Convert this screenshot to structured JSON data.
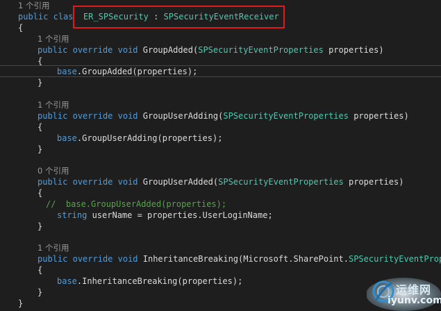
{
  "editor": {
    "lines": [
      {
        "id": "l0",
        "kind": "lens",
        "text": "1 个引用"
      },
      {
        "id": "l1",
        "parts": [
          {
            "c": "kw",
            "t": "public"
          },
          {
            "c": "plain",
            "t": " "
          },
          {
            "c": "kw",
            "t": "clas"
          },
          {
            "c": "plain",
            "t": "  "
          },
          {
            "c": "type",
            "t": "ER_SPSecurity"
          },
          {
            "c": "plain",
            "t": " : "
          },
          {
            "c": "type",
            "t": "SPSecurityEventReceiver"
          }
        ]
      },
      {
        "id": "l2",
        "parts": [
          {
            "c": "plain",
            "t": "{"
          }
        ]
      },
      {
        "id": "l3",
        "kind": "lens",
        "text": "1 个引用"
      },
      {
        "id": "l4",
        "parts": [
          {
            "c": "kw",
            "t": "public"
          },
          {
            "c": "plain",
            "t": " "
          },
          {
            "c": "kw",
            "t": "override"
          },
          {
            "c": "plain",
            "t": " "
          },
          {
            "c": "kw",
            "t": "void"
          },
          {
            "c": "plain",
            "t": " GroupAdded("
          },
          {
            "c": "type",
            "t": "SPSecurityEventProperties"
          },
          {
            "c": "plain",
            "t": " properties)"
          }
        ]
      },
      {
        "id": "l5",
        "parts": [
          {
            "c": "plain",
            "t": "{"
          }
        ]
      },
      {
        "id": "l6",
        "parts": [
          {
            "c": "kw",
            "t": "base"
          },
          {
            "c": "plain",
            "t": ".GroupAdded(properties);"
          }
        ]
      },
      {
        "id": "l7",
        "parts": [
          {
            "c": "plain",
            "t": "}"
          }
        ]
      },
      {
        "id": "l8",
        "kind": "lens",
        "text": "1 个引用"
      },
      {
        "id": "l9",
        "parts": [
          {
            "c": "kw",
            "t": "public"
          },
          {
            "c": "plain",
            "t": " "
          },
          {
            "c": "kw",
            "t": "override"
          },
          {
            "c": "plain",
            "t": " "
          },
          {
            "c": "kw",
            "t": "void"
          },
          {
            "c": "plain",
            "t": " GroupUserAdding("
          },
          {
            "c": "type",
            "t": "SPSecurityEventProperties"
          },
          {
            "c": "plain",
            "t": " properties)"
          }
        ]
      },
      {
        "id": "l10",
        "parts": [
          {
            "c": "plain",
            "t": "{"
          }
        ]
      },
      {
        "id": "l11",
        "parts": [
          {
            "c": "kw",
            "t": "base"
          },
          {
            "c": "plain",
            "t": ".GroupUserAdding(properties);"
          }
        ]
      },
      {
        "id": "l12",
        "parts": [
          {
            "c": "plain",
            "t": "}"
          }
        ]
      },
      {
        "id": "l13",
        "kind": "lens",
        "text": "0 个引用"
      },
      {
        "id": "l14",
        "parts": [
          {
            "c": "kw",
            "t": "public"
          },
          {
            "c": "plain",
            "t": " "
          },
          {
            "c": "kw",
            "t": "override"
          },
          {
            "c": "plain",
            "t": " "
          },
          {
            "c": "kw",
            "t": "void"
          },
          {
            "c": "plain",
            "t": " GroupUserAdded("
          },
          {
            "c": "type",
            "t": "SPSecurityEventProperties"
          },
          {
            "c": "plain",
            "t": " properties)"
          }
        ]
      },
      {
        "id": "l15",
        "parts": [
          {
            "c": "plain",
            "t": "{"
          }
        ]
      },
      {
        "id": "l16",
        "parts": [
          {
            "c": "comment",
            "t": "//  base.GroupUserAdded(properties);"
          }
        ]
      },
      {
        "id": "l17",
        "parts": [
          {
            "c": "kw",
            "t": "string"
          },
          {
            "c": "plain",
            "t": " userName = properties.UserLoginName;"
          }
        ]
      },
      {
        "id": "l18",
        "parts": [
          {
            "c": "plain",
            "t": "}"
          }
        ]
      },
      {
        "id": "l19",
        "kind": "lens",
        "text": "1 个引用"
      },
      {
        "id": "l20",
        "parts": [
          {
            "c": "kw",
            "t": "public"
          },
          {
            "c": "plain",
            "t": " "
          },
          {
            "c": "kw",
            "t": "override"
          },
          {
            "c": "plain",
            "t": " "
          },
          {
            "c": "kw",
            "t": "void"
          },
          {
            "c": "plain",
            "t": " InheritanceBreaking(Microsoft.SharePoint."
          },
          {
            "c": "type",
            "t": "SPSecurityEventPropert"
          }
        ]
      },
      {
        "id": "l21",
        "parts": [
          {
            "c": "plain",
            "t": "{"
          }
        ]
      },
      {
        "id": "l22",
        "parts": [
          {
            "c": "kw",
            "t": "base"
          },
          {
            "c": "plain",
            "t": ".InheritanceBreaking(properties);"
          }
        ]
      },
      {
        "id": "l23",
        "parts": [
          {
            "c": "plain",
            "t": "}"
          }
        ]
      },
      {
        "id": "l24",
        "parts": [
          {
            "c": "plain",
            "t": "}"
          }
        ]
      }
    ]
  },
  "watermark": {
    "name": "运维网",
    "url": "iyunv.com"
  },
  "colors": {
    "keyword": "#569cd6",
    "type": "#4ec9b0",
    "comment": "#57a64a",
    "highlight": "#e01b1b"
  }
}
